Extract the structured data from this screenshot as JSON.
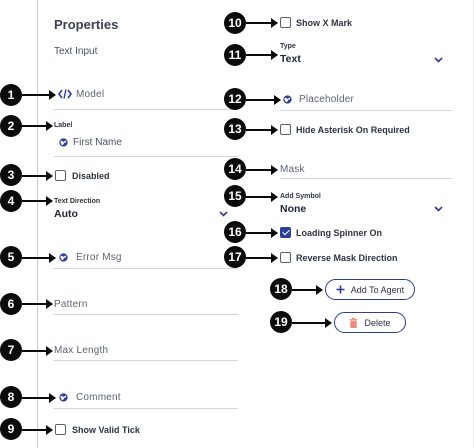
{
  "panel": {
    "title": "Properties",
    "component_name": "Text Input"
  },
  "left": {
    "model": {
      "label": "Model"
    },
    "label_field": {
      "label": "Label",
      "value": "First Name"
    },
    "disabled": {
      "label": "Disabled",
      "checked": false
    },
    "text_direction": {
      "label": "Text Direction",
      "value": "Auto"
    },
    "error_msg": {
      "placeholder": "Error Msg"
    },
    "pattern": {
      "placeholder": "Pattern"
    },
    "max_length": {
      "placeholder": "Max Length"
    },
    "comment": {
      "placeholder": "Comment"
    },
    "show_valid_tick": {
      "label": "Show Valid Tick",
      "checked": false
    }
  },
  "right": {
    "show_x_mark": {
      "label": "Show X Mark",
      "checked": false
    },
    "type": {
      "label": "Type",
      "value": "Text"
    },
    "placeholder_field": {
      "placeholder": "Placeholder"
    },
    "hide_asterisk": {
      "label": "Hide Asterisk On Required",
      "checked": false
    },
    "mask": {
      "placeholder": "Mask"
    },
    "add_symbol": {
      "label": "Add Symbol",
      "value": "None"
    },
    "loading_spinner": {
      "label": "Loading Spinner On",
      "checked": true
    },
    "reverse_mask": {
      "label": "Reverse Mask Direction",
      "checked": false
    },
    "add_to_agent_label": "Add To Agent",
    "delete_label": "Delete"
  },
  "callouts": [
    "1",
    "2",
    "3",
    "4",
    "5",
    "6",
    "7",
    "8",
    "9",
    "10",
    "11",
    "12",
    "13",
    "14",
    "15",
    "16",
    "17",
    "18",
    "19"
  ],
  "colors": {
    "accent": "#2d3e95",
    "delete_icon": "#f08a7a",
    "callout": "#0b0b0b"
  },
  "icons": {
    "model": "code-icon",
    "translate": "globe-icon",
    "dropdown": "chevron-down-icon",
    "add": "plus-icon",
    "delete": "trash-icon"
  }
}
